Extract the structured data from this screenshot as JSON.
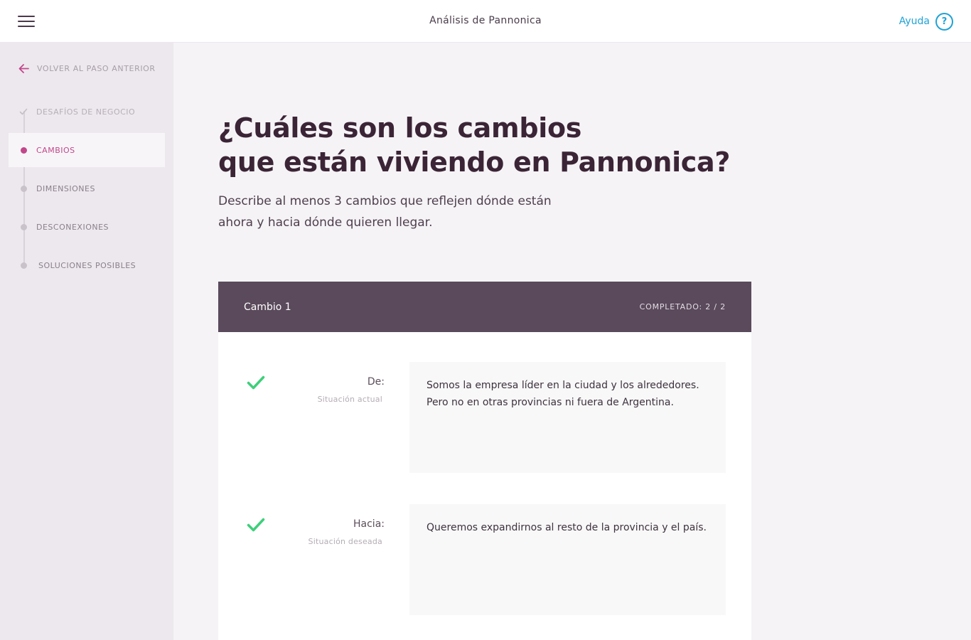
{
  "header": {
    "title": "Análisis de Pannonica",
    "help_label": "Ayuda",
    "help_glyph": "?"
  },
  "sidebar": {
    "back_label": "VOLVER AL PASO ANTERIOR",
    "steps": [
      {
        "label": "DESAFÍOS DE NEGOCIO",
        "state": "done"
      },
      {
        "label": "CAMBIOS",
        "state": "active"
      },
      {
        "label": "DIMENSIONES",
        "state": "pending"
      },
      {
        "label": "DESCONEXIONES",
        "state": "pending"
      },
      {
        "label": "SOLUCIONES POSIBLES",
        "state": "pending"
      }
    ]
  },
  "main": {
    "heading_line1": "¿Cuáles son los cambios",
    "heading_line2": "que están viviendo en Pannonica?",
    "subtitle": "Describe al menos 3 cambios que reflejen dónde están ahora y hacia dónde quieren llegar.",
    "card": {
      "title": "Cambio 1",
      "status": "COMPLETADO: 2 / 2",
      "fields": [
        {
          "label": "De:",
          "hint": "Situación actual",
          "value": "Somos la empresa líder en la ciudad y los alrededores. Pero no en otras provincias ni fuera de Argentina.",
          "completed": true
        },
        {
          "label": "Hacia:",
          "hint": "Situación deseada",
          "value": "Queremos expandirnos al resto de la provincia y el país.",
          "completed": true
        }
      ]
    }
  },
  "colors": {
    "accent": "#c2478a",
    "help": "#1fa3d6",
    "check": "#3ecf7a",
    "card_header": "#5a4a5b"
  },
  "icons": {
    "menu": "hamburger-icon",
    "back": "arrow-left-icon",
    "help": "question-circle-icon",
    "check": "check-icon"
  }
}
